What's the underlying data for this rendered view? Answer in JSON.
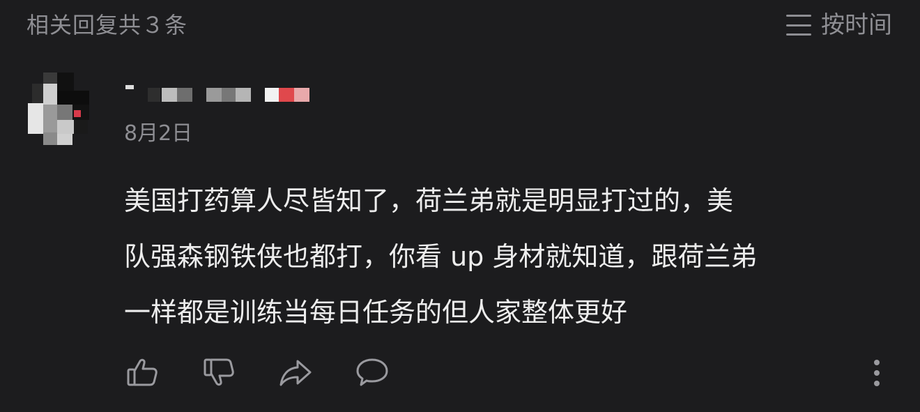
{
  "header": {
    "title": "相关回复共３条",
    "sort_label": "按时间",
    "sort_icon": "list-sort-icon"
  },
  "comment": {
    "username_censored": true,
    "date": "8月2日",
    "lines": [
      "美国打药算人尽皆知了，荷兰弟就是明显打过的，美",
      "队强森钢铁侠也都打，你看 up 身材就知道，跟荷兰弟",
      "一样都是训练当每日任务的但人家整体更好"
    ],
    "actions": {
      "like_icon": "thumbs-up-icon",
      "dislike_icon": "thumbs-down-icon",
      "share_icon": "share-icon",
      "reply_icon": "comment-bubble-icon",
      "more_icon": "more-vertical-icon"
    }
  },
  "colors": {
    "background": "#1c1c1e",
    "secondary_text": "#8e8e93",
    "primary_text": "#ededed",
    "icon": "#9a9a9f"
  }
}
